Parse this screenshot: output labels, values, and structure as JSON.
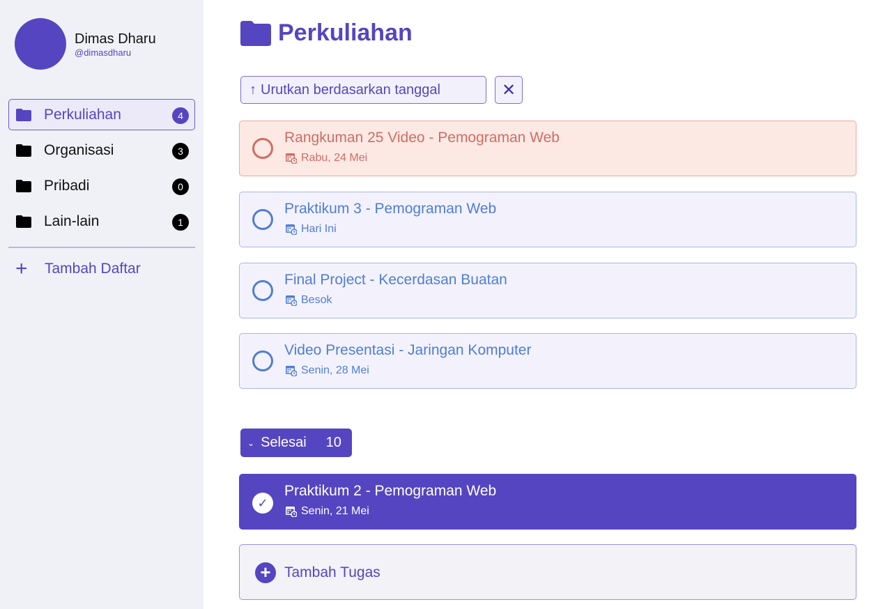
{
  "profile": {
    "name": "Dimas Dharu",
    "handle": "@dimasdharu"
  },
  "sidebar": {
    "items": [
      {
        "label": "Perkuliahan",
        "count": "4",
        "active": true
      },
      {
        "label": "Organisasi",
        "count": "3",
        "active": false
      },
      {
        "label": "Pribadi",
        "count": "0",
        "active": false
      },
      {
        "label": "Lain-lain",
        "count": "1",
        "active": false
      }
    ],
    "add_list_label": "Tambah Daftar"
  },
  "main": {
    "title": "Perkuliahan",
    "sort_label": "Urutkan berdasarkan tanggal",
    "sort_arrow": "↑",
    "close_glyph": "✕",
    "tasks": [
      {
        "title": "Rangkuman 25 Video - Pemograman Web",
        "date": "Rabu, 24 Mei",
        "status": "overdue"
      },
      {
        "title": "Praktikum 3 - Pemograman Web",
        "date": "Hari Ini",
        "status": "pending"
      },
      {
        "title": "Final Project - Kecerdasan Buatan",
        "date": "Besok",
        "status": "pending"
      },
      {
        "title": "Video Presentasi - Jaringan Komputer",
        "date": "Senin, 28 Mei",
        "status": "pending"
      }
    ],
    "done_section": {
      "label": "Selesai",
      "count": "10",
      "chevron": "⌄"
    },
    "done_tasks": [
      {
        "title": "Praktikum 2 - Pemograman Web",
        "date": "Senin, 21 Mei",
        "status": "done"
      }
    ],
    "add_task_label": "Tambah Tugas",
    "check_glyph": "✓",
    "plus_glyph": "+"
  },
  "colors": {
    "accent": "#5545c1",
    "pending": "#4f7dd6",
    "overdue": "#cd6d65",
    "overdue_bg": "#fde9e4",
    "sidebar_bg": "#f0f1f7"
  },
  "icons": {
    "folder": "folder-icon",
    "calendar": "calendar-clock-icon",
    "plus": "plus-icon",
    "close": "close-icon",
    "check": "check-icon",
    "chevron": "chevron-down-icon"
  }
}
